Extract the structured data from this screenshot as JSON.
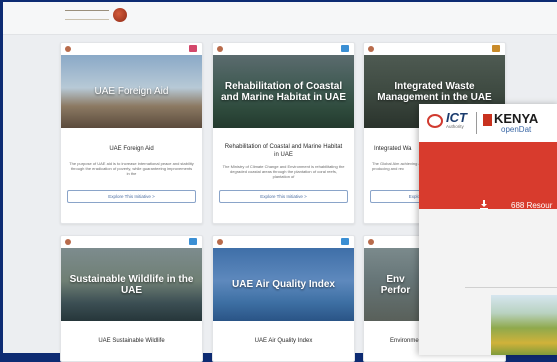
{
  "cards": [
    {
      "title": "UAE Foreign Aid",
      "image_caption": "UAE Foreign Aid",
      "description": "The purpose of UAE aid is to increase international peace and stability through the eradication of poverty, while guaranteeing improvements in the",
      "button": "Explore This Initiative >"
    },
    {
      "title": "Rehabilitation of Coastal and Marine Habitat in UAE",
      "image_caption": "Rehabilitation of Coastal and Marine Habitat in UAE",
      "description": "The Ministry of Climate Change and Environment is rehabilitating the degraded coastal areas through the plantation of coral reefs, plantation of",
      "button": "Explore This Initiative >"
    },
    {
      "title": "Integrated Wa",
      "image_caption": "Integrated Waste Management in the UAE",
      "description": "The Global Aim achieving an integ producing and rec",
      "button": "Explo"
    },
    {
      "title": "UAE Sustainable Wildlife",
      "image_caption": "Sustainable Wildlife in the UAE",
      "description": "",
      "button": ""
    },
    {
      "title": "UAE Air Quality Index",
      "image_caption": "UAE Air Quality Index",
      "description": "",
      "button": ""
    },
    {
      "title": "Environme Ev",
      "image_caption": "Env Perfor",
      "description": "",
      "button": ""
    }
  ],
  "overlay": {
    "ict_brand": "ICT",
    "ict_sub": "Authority",
    "kenya_brand": "KENYA",
    "kenya_sub": "openDat",
    "resources": "688 Resour"
  }
}
